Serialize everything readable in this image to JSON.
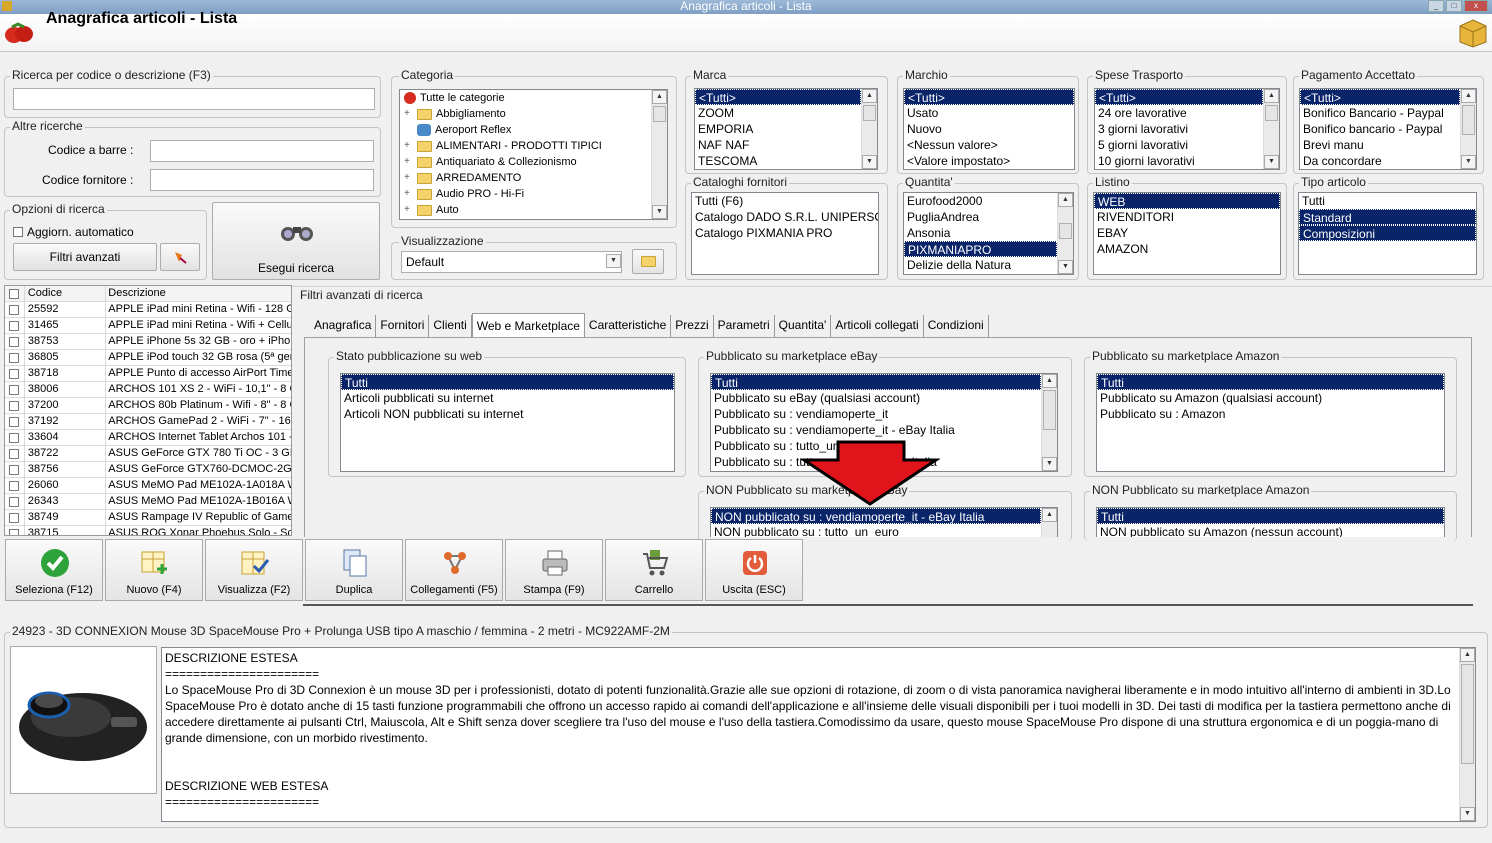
{
  "window": {
    "title": "Anagrafica articoli  - Lista"
  },
  "header": {
    "title": "Anagrafica articoli  - Lista"
  },
  "search": {
    "label": "Ricerca per codice o descrizione (F3)",
    "value": ""
  },
  "other_search": {
    "label": "Altre ricerche",
    "barcode_label": "Codice a barre :",
    "supplier_code_label": "Codice fornitore :"
  },
  "options": {
    "label": "Opzioni di ricerca",
    "auto_update": "Aggiorn. automatico",
    "advanced_filters": "Filtri avanzati",
    "run_search": "Esegui ricerca"
  },
  "category": {
    "label": "Categoria",
    "items": [
      "Tutte le categorie",
      "Abbigliamento",
      "Aeroport Reflex",
      "ALIMENTARI - PRODOTTI TIPICI",
      "Antiquariato & Collezionismo",
      "ARREDAMENTO",
      "Audio PRO - Hi-Fi",
      "Auto"
    ]
  },
  "view": {
    "label": "Visualizzazione",
    "value": "Default"
  },
  "marca": {
    "label": "Marca",
    "items": [
      "<Tutti>",
      "ZOOM",
      "EMPORIA",
      "NAF NAF",
      "TESCOMA"
    ]
  },
  "marchio": {
    "label": "Marchio",
    "items": [
      "<Tutti>",
      "Usato",
      "Nuovo",
      "<Nessun valore>",
      "<Valore impostato>"
    ]
  },
  "spese": {
    "label": "Spese Trasporto",
    "items": [
      "<Tutti>",
      "24 ore lavorative",
      "3 giorni lavorativi",
      "5 giorni lavorativi",
      "10 giorni lavorativi"
    ]
  },
  "pagamento": {
    "label": "Pagamento Accettato",
    "items": [
      "<Tutti>",
      "Bonifico Bancario -  Paypal",
      "Bonifico bancario - Paypal",
      "Brevi manu",
      "Da concordare"
    ]
  },
  "cataloghi": {
    "label": "Cataloghi fornitori",
    "items": [
      "Tutti (F6)",
      "Catalogo DADO S.R.L. UNIPERSO",
      "Catalogo PIXMANIA PRO"
    ]
  },
  "quantita": {
    "label": "Quantita'",
    "items": [
      "Eurofood2000",
      "PugliaAndrea",
      "Ansonia",
      "PIXMANIAPRO",
      "Delizie della Natura"
    ]
  },
  "listino": {
    "label": "Listino",
    "items": [
      "WEB",
      "RIVENDITORI",
      "EBAY",
      "AMAZON"
    ]
  },
  "tipo": {
    "label": "Tipo articolo",
    "items": [
      "Tutti",
      "Standard",
      "Composizioni"
    ]
  },
  "grid": {
    "headers": [
      "Codice",
      "Descrizione"
    ],
    "rows": [
      [
        "25592",
        "APPLE iPad mini Retina - Wifi - 128 GB..."
      ],
      [
        "31465",
        "APPLE iPad mini Retina - Wifi + Cellula..."
      ],
      [
        "38753",
        "APPLE iPhone 5s 32 GB - oro + iPhone..."
      ],
      [
        "36805",
        "APPLE iPod touch 32 GB rosa (5ª gen..."
      ],
      [
        "38718",
        "APPLE Punto di accesso AirPort Time ..."
      ],
      [
        "38006",
        "ARCHOS 101 XS 2 - WiFi - 10,1\" - 8 G..."
      ],
      [
        "37200",
        "ARCHOS 80b Platinum - Wifi - 8\" - 8 G..."
      ],
      [
        "37192",
        "ARCHOS GamePad 2 - WiFi - 7\" - 16 G..."
      ],
      [
        "33604",
        "ARCHOS Internet Tablet Archos 101 -..."
      ],
      [
        "38722",
        "ASUS GeForce GTX 780 Ti OC - 3 GB ..."
      ],
      [
        "38756",
        "ASUS GeForce GTX760-DCMOC-2GD5..."
      ],
      [
        "26060",
        "ASUS MeMO Pad ME102A-1A018A Wi..."
      ],
      [
        "26343",
        "ASUS MeMO Pad ME102A-1B016A Wi..."
      ],
      [
        "38749",
        "ASUS Rampage IV Republic of Gamers..."
      ],
      [
        "38715",
        "ASUS ROG Xonar Phoebus Solo - Sche..."
      ]
    ]
  },
  "advanced": {
    "label": "Filtri avanzati di ricerca",
    "tabs": [
      "Anagrafica",
      "Fornitori",
      "Clienti",
      "Web e Marketplace",
      "Caratteristiche",
      "Prezzi",
      "Parametri",
      "Quantita'",
      "Articoli collegati",
      "Condizioni"
    ],
    "web_status": {
      "label": "Stato pubblicazione su web",
      "items": [
        "Tutti",
        "Articoli pubblicati su internet",
        "Articoli NON pubblicati su internet"
      ]
    },
    "ebay_pub": {
      "label": "Pubblicato su marketplace eBay",
      "items": [
        "Tutti",
        "Pubblicato su eBay (qualsiasi account)",
        "Pubblicato su : vendiamoperte_it",
        "Pubblicato su : vendiamoperte_it - eBay Italia",
        "Pubblicato su : tutto_un_euro",
        "Pubblicato su : tutto_un_euro - eBay Italia"
      ]
    },
    "amazon_pub": {
      "label": "Pubblicato su marketplace Amazon",
      "items": [
        "Tutti",
        "Pubblicato su Amazon (qualsiasi account)",
        "Pubblicato su : Amazon"
      ]
    },
    "ebay_nonpub": {
      "label": "NON Pubblicato su marketplace eBay",
      "items": [
        "NON pubblicato su : vendiamoperte_it - eBay Italia",
        "NON pubblicato su : tutto_un_euro"
      ]
    },
    "amazon_nonpub": {
      "label": "NON Pubblicato su marketplace Amazon",
      "items": [
        "Tutti",
        "NON pubblicato su Amazon (nessun account)"
      ]
    }
  },
  "toolbar": [
    "Seleziona (F12)",
    "Nuovo (F4)",
    "Visualizza (F2)",
    "Duplica",
    "Collegamenti (F5)",
    "Stampa (F9)",
    "Carrello",
    "Uscita (ESC)"
  ],
  "detail": {
    "title": "24923 - 3D CONNEXION Mouse 3D SpaceMouse Pro + Prolunga USB tipo A maschio / femmina - 2 metri - MC922AMF-2M",
    "lines": [
      "DESCRIZIONE ESTESA",
      "======================",
      "Lo SpaceMouse Pro di 3D Connexion è un mouse 3D per i professionisti, dotato di potenti funzionalità.Grazie alle sue opzioni di rotazione, di zoom o di vista panoramica navigherai liberamente e in modo intuitivo all'interno di ambienti in 3D.Lo SpaceMouse Pro è dotato anche di 15 tasti funzione programmabili che offrono un accesso rapido ai comandi dell'applicazione e all'insieme delle visuali disponibili per i tuoi modelli in 3D. Dei tasti di modifica per la tastiera permettono anche di accedere direttamente ai pulsanti Ctrl, Maiuscola, Alt e Shift senza dover scegliere tra l'uso del mouse e l'uso della tastiera.Comodissimo da usare, questo mouse SpaceMouse Pro dispone di una struttura ergonomica e di un poggia-mano di grande dimensione, con un morbido rivestimento.",
      "",
      "",
      "DESCRIZIONE WEB ESTESA",
      "======================"
    ]
  },
  "colors": {
    "selection": "#0a246a",
    "arrow": "#e0141a"
  }
}
